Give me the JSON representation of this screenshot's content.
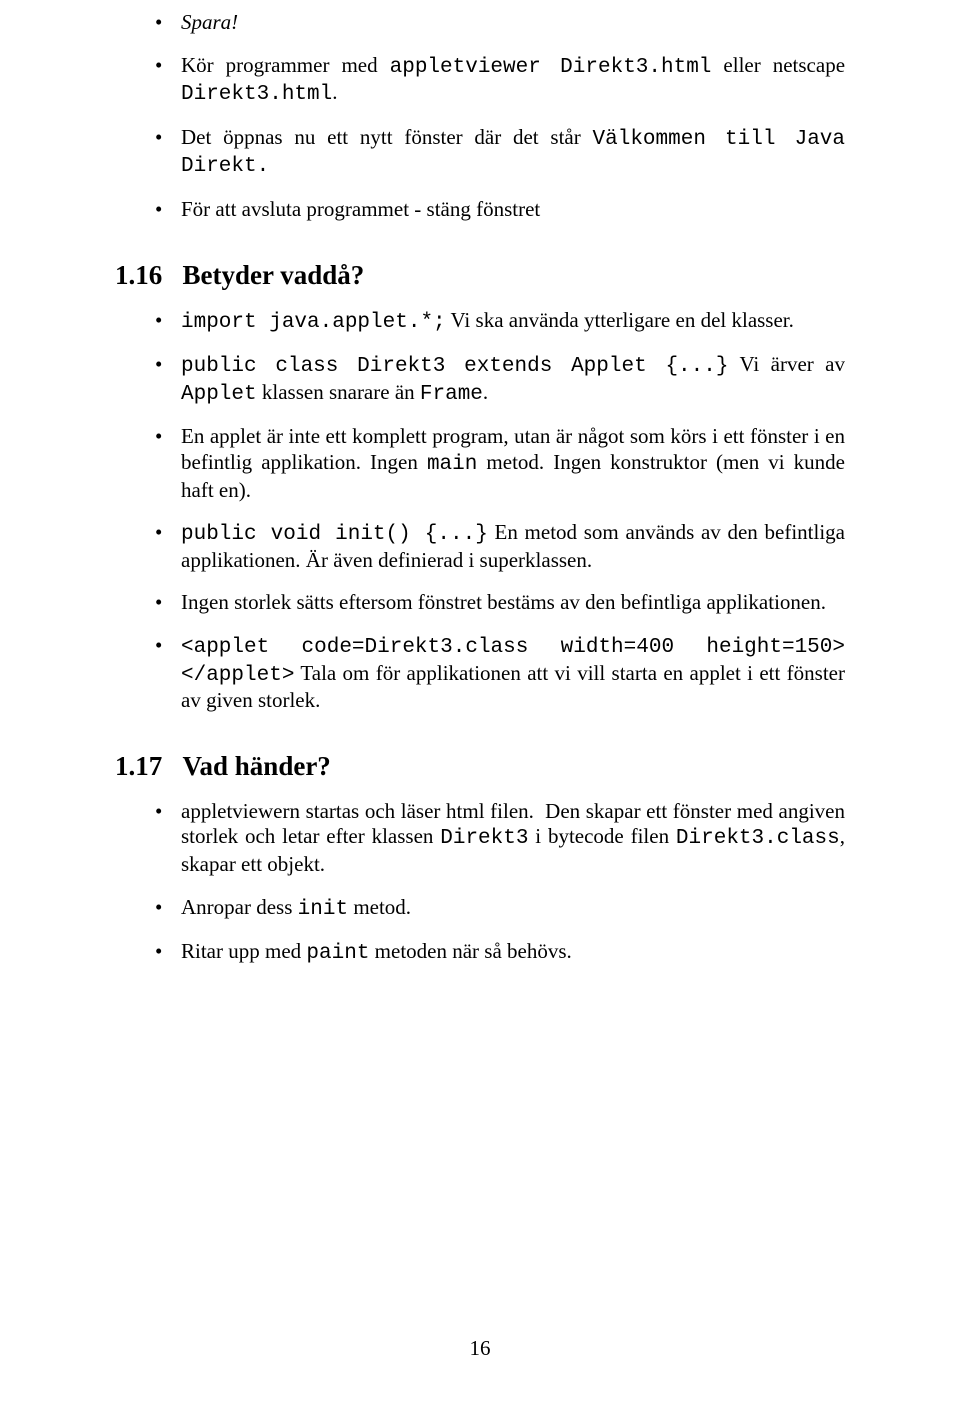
{
  "list1": {
    "items": [
      {
        "html": "<span class=\"italic\">Spara!</span>"
      },
      {
        "html": "Kör programmer med <span class=\"tt\">appletviewer Direkt3.html</span> eller netscape <span class=\"tt\">Direkt3.html</span>."
      },
      {
        "html": "Det öppnas nu ett nytt fönster där det står <span class=\"tt\">Välkommen till Java Direkt.</span>"
      },
      {
        "html": "För att avsluta programmet - stäng fönstret"
      }
    ]
  },
  "section116": {
    "number": "1.16",
    "title": "Betyder vaddå?"
  },
  "list2": {
    "items": [
      {
        "html": "<span class=\"tt\">import java.applet.*;</span> Vi ska använda ytterligare en del klasser."
      },
      {
        "html": "<span class=\"tt\">public class Direkt3 extends Applet {...}</span> Vi ärver av <span class=\"tt\">Applet</span> klassen snarare än <span class=\"tt\">Frame</span>."
      },
      {
        "html": "En applet är inte ett komplett program, utan är något som körs i ett fönster i en befintlig applikation. Ingen <span class=\"tt\">main</span> metod. Ingen konstruktor (men vi kunde haft en)."
      },
      {
        "html": "<span class=\"tt\">public void init() {...}</span> En metod som används av den befintliga applikationen. Är även definierad i superklassen."
      },
      {
        "html": "Ingen storlek sätts eftersom fönstret bestäms av den befintliga applikationen."
      },
      {
        "html": "<span class=\"tt\">&lt;applet code=Direkt3.class width=400 height=150&gt;&lt;/applet&gt;</span> Tala om för applikationen att vi vill starta en applet i ett fönster av given storlek."
      }
    ]
  },
  "section117": {
    "number": "1.17",
    "title": "Vad händer?"
  },
  "list3": {
    "items": [
      {
        "html": "appletviewern startas och läser html filen.&nbsp;&nbsp;Den skapar ett fönster med angiven storlek och letar efter klassen <span class=\"tt\">Direkt3</span> i bytecode filen <span class=\"tt\">Direkt3.class</span>, skapar ett objekt."
      },
      {
        "html": "Anropar dess <span class=\"tt\">init</span> metod."
      },
      {
        "html": "Ritar upp med <span class=\"tt\">paint</span> metoden när så behövs."
      }
    ]
  },
  "pagenum": "16"
}
